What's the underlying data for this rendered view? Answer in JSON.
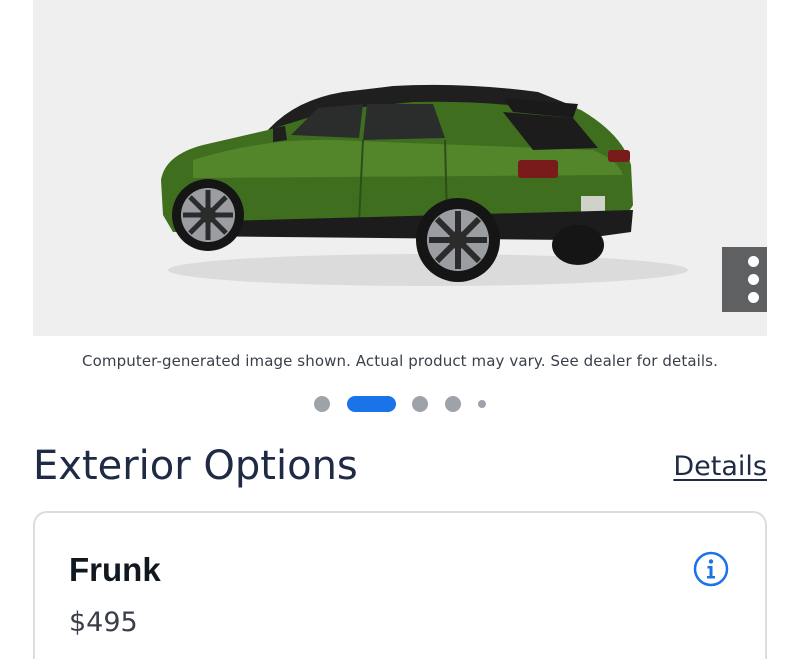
{
  "hero": {
    "image_icon": "car-side-rear-view",
    "menu_icon": "more-vertical-icon"
  },
  "disclaimer": "Computer-generated image shown. Actual product may vary. See dealer for details.",
  "carousel": {
    "slide_count": 5,
    "active_index": 1
  },
  "section": {
    "title": "Exterior Options",
    "details_link": "Details"
  },
  "option": {
    "name": "Frunk",
    "price": "$495",
    "info_icon": "info-circle-icon"
  },
  "colors": {
    "accent": "#1a73e8",
    "title": "#1f2a44",
    "car_body": "#3f6e1f"
  }
}
